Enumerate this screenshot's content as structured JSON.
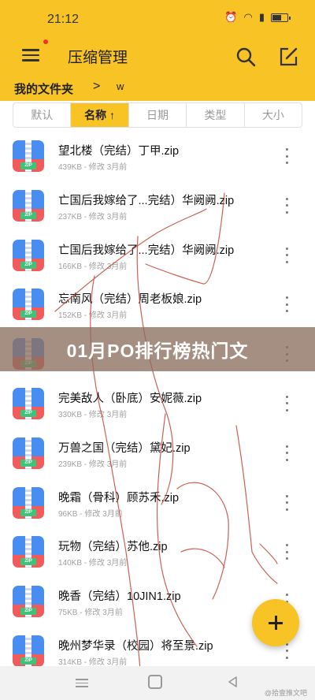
{
  "status": {
    "time": "21:12",
    "battery_level": 0.6
  },
  "app_bar": {
    "title": "压缩管理",
    "icons": [
      "menu-icon",
      "search-icon",
      "edit-icon"
    ]
  },
  "breadcrumb": {
    "root": "我的文件夹",
    "separator": ">",
    "current": "w"
  },
  "sort": {
    "tabs": [
      "默认",
      "名称 ↑",
      "日期",
      "类型",
      "大小"
    ],
    "active_index": 1
  },
  "files": [
    {
      "name": "望北楼（完结）丁甲.zip",
      "meta": "439KB - 修改 3月前"
    },
    {
      "name": "亡国后我嫁给了...完结）华阙阙.zip",
      "meta": "237KB - 修改 3月前"
    },
    {
      "name": "亡国后我嫁给了...完结）华阙阙.zip",
      "meta": "166KB - 修改 3月前"
    },
    {
      "name": "忘南风（完结）周老板娘.zip",
      "meta": "152KB - 修改 3月前"
    },
    {
      "name": "",
      "meta": ""
    },
    {
      "name": "完美敌人（卧底）安妮薇.zip",
      "meta": "330KB - 修改 3月前"
    },
    {
      "name": "万兽之国（完结）黛妃.zip",
      "meta": "239KB - 修改 3月前"
    },
    {
      "name": "晚霜（骨科）顾苏禾.zip",
      "meta": "96KB - 修改 3月前"
    },
    {
      "name": "玩物（完结）苏他.zip",
      "meta": "140KB - 修改 3月前"
    },
    {
      "name": "晚香（完结）10JIN1.zip",
      "meta": "75KB - 修改 3月前"
    },
    {
      "name": "晚州梦华录（校园）将至景.zip",
      "meta": "314KB - 修改 3月前"
    }
  ],
  "zip_tag": "ZIP",
  "banner": {
    "text": "01月PO排行榜热门文"
  },
  "fab": {
    "icon": "plus-icon"
  },
  "nav": {
    "watermark": "@拾壹推文吧"
  },
  "colors": {
    "accent": "#f7c325",
    "scribble": "#c0392b",
    "banner": "#8c6e5f"
  }
}
